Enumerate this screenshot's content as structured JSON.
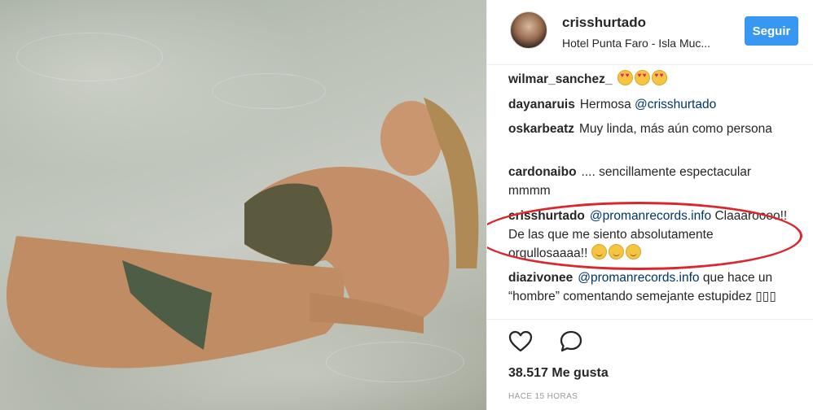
{
  "post": {
    "author": "crisshurtado",
    "location": "Hotel Punta Faro - Isla Muc...",
    "follow_label": "Seguir"
  },
  "comments": [
    {
      "user": "wilmar_sanchez_",
      "text": "",
      "emoji": [
        "heart-eyes",
        "heart-eyes",
        "heart-eyes"
      ]
    },
    {
      "user": "dayanaruis",
      "text": "Hermosa ",
      "mention": "@crisshurtado"
    },
    {
      "user": "oskarbeatz",
      "text": "Muy linda, más aún como persona"
    },
    {
      "user": "cardonaibo",
      "text": ".... sencillamente espectacular mmmm"
    },
    {
      "user": "crisshurtado",
      "mention": "@promanrecords.info",
      "text": " Claaaroooo!! De las que me siento absolutamente orgullosaaaa!! ",
      "emoji": [
        "smile",
        "smile",
        "smile"
      ]
    },
    {
      "user": "diazivonee",
      "mention": "@promanrecords.info",
      "text": " que hace un “hombre” comentando semejante estupidez ▯▯▯"
    }
  ],
  "stats": {
    "likes": "38.517 Me gusta",
    "time": "HACE 15 HORAS"
  },
  "icons": {
    "like": "heart-outline-icon",
    "comment": "speech-bubble-icon"
  },
  "colors": {
    "follow_button": "#3897f0",
    "highlight": "#d9262f",
    "mention": "#003569"
  }
}
